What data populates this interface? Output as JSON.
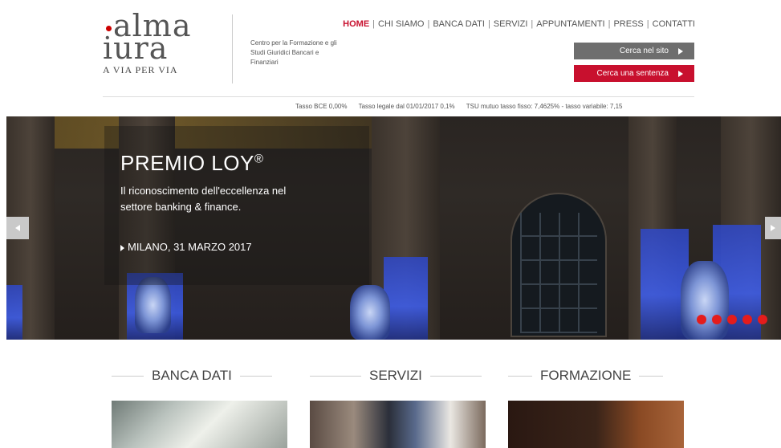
{
  "logo": {
    "line1": "alma",
    "line2": "iura",
    "tagline": "A VIA PER VIA"
  },
  "header": {
    "description": "Centro per la Formazione e gli Studi Giuridici Bancari e Finanziari"
  },
  "nav": {
    "items": [
      {
        "label": "HOME",
        "active": true
      },
      {
        "label": "CHI SIAMO",
        "active": false
      },
      {
        "label": "BANCA DATI",
        "active": false
      },
      {
        "label": "SERVIZI",
        "active": false
      },
      {
        "label": "APPUNTAMENTI",
        "active": false
      },
      {
        "label": "PRESS",
        "active": false
      },
      {
        "label": "CONTATTI",
        "active": false
      }
    ]
  },
  "buttons": {
    "search": "Cerca nel sito",
    "sentenza": "Cerca una sentenza"
  },
  "rates": {
    "bce": "Tasso BCE 0,00%",
    "legale": "Tasso legale dal 01/01/2017 0,1%",
    "tsu": "TSU mutuo tasso fisso: 7,4625% - tasso variabile: 7,15"
  },
  "hero": {
    "title": "PREMIO LOY",
    "title_mark": "®",
    "subtitle": "Il riconoscimento dell'eccellenza nel settore banking & finance.",
    "date": "MILANO, 31 MARZO 2017",
    "slide_count": 5
  },
  "sections": [
    {
      "title": "BANCA DATI"
    },
    {
      "title": "SERVIZI"
    },
    {
      "title": "FORMAZIONE"
    }
  ],
  "colors": {
    "accent": "#c8102e",
    "button_grey": "#6e6e6e",
    "dot": "#e41c1c"
  }
}
